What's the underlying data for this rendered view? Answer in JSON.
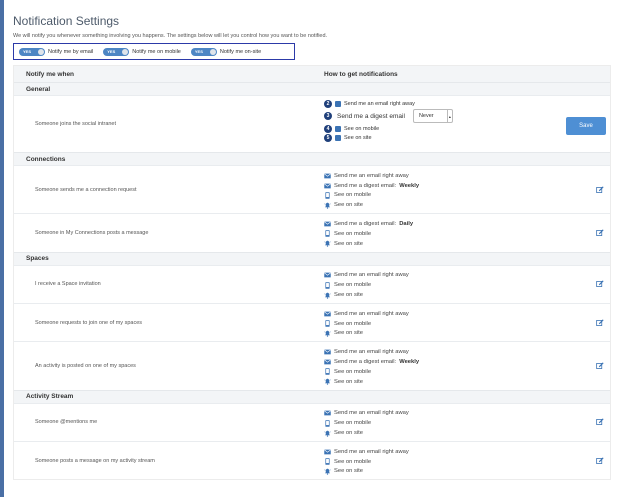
{
  "page": {
    "title": "Notification Settings",
    "intro": "We will notify you whenever something involving you happens. The settings below will let you control how you want to be notified."
  },
  "master": {
    "badge": "1",
    "toggles": [
      {
        "state": "YES",
        "label": "Notify me by email"
      },
      {
        "state": "YES",
        "label": "Notify me on mobile"
      },
      {
        "state": "YES",
        "label": "Notify me on-site"
      }
    ]
  },
  "table": {
    "col_when": "Notify me when",
    "col_how": "How to get notifications"
  },
  "general": {
    "title": "General",
    "row_label": "Someone joins the social intranet",
    "badges": [
      "2",
      "3",
      "4",
      "5"
    ],
    "email_label": "Send me an email right away",
    "digest_label": "Send me a digest email",
    "digest_value": "Never",
    "mobile_label": "See on mobile",
    "site_label": "See on site",
    "save_label": "Save"
  },
  "sections": [
    {
      "title": "Connections",
      "rows": [
        {
          "label": "Someone sends me a connection request",
          "lines": [
            {
              "icon": "email-icon",
              "text": "Send me an email right away",
              "strong": ""
            },
            {
              "icon": "email-icon",
              "text": "Send me a digest email: ",
              "strong": "Weekly"
            },
            {
              "icon": "mobile-icon",
              "text": "See on mobile",
              "strong": ""
            },
            {
              "icon": "bell-icon",
              "text": "See on site",
              "strong": ""
            }
          ]
        },
        {
          "label": "Someone in My Connections posts a message",
          "lines": [
            {
              "icon": "email-icon",
              "text": "Send me a digest email: ",
              "strong": "Daily"
            },
            {
              "icon": "mobile-icon",
              "text": "See on mobile",
              "strong": ""
            },
            {
              "icon": "bell-icon",
              "text": "See on site",
              "strong": ""
            }
          ]
        }
      ]
    },
    {
      "title": "Spaces",
      "rows": [
        {
          "label": "I receive a Space invitation",
          "lines": [
            {
              "icon": "email-icon",
              "text": "Send me an email right away",
              "strong": ""
            },
            {
              "icon": "mobile-icon",
              "text": "See on mobile",
              "strong": ""
            },
            {
              "icon": "bell-icon",
              "text": "See on site",
              "strong": ""
            }
          ]
        },
        {
          "label": "Someone requests to join one of my spaces",
          "lines": [
            {
              "icon": "email-icon",
              "text": "Send me an email right away",
              "strong": ""
            },
            {
              "icon": "mobile-icon",
              "text": "See on mobile",
              "strong": ""
            },
            {
              "icon": "bell-icon",
              "text": "See on site",
              "strong": ""
            }
          ]
        },
        {
          "label": "An activity is posted on one of my spaces",
          "lines": [
            {
              "icon": "email-icon",
              "text": "Send me an email right away",
              "strong": ""
            },
            {
              "icon": "email-icon",
              "text": "Send me a digest email: ",
              "strong": "Weekly"
            },
            {
              "icon": "mobile-icon",
              "text": "See on mobile",
              "strong": ""
            },
            {
              "icon": "bell-icon",
              "text": "See on site",
              "strong": ""
            }
          ]
        }
      ]
    },
    {
      "title": "Activity Stream",
      "rows": [
        {
          "label": "Someone @mentions me",
          "lines": [
            {
              "icon": "email-icon",
              "text": "Send me an email right away",
              "strong": ""
            },
            {
              "icon": "mobile-icon",
              "text": "See on mobile",
              "strong": ""
            },
            {
              "icon": "bell-icon",
              "text": "See on site",
              "strong": ""
            }
          ]
        },
        {
          "label": "Someone posts a message on my activity stream",
          "lines": [
            {
              "icon": "email-icon",
              "text": "Send me an email right away",
              "strong": ""
            },
            {
              "icon": "mobile-icon",
              "text": "See on mobile",
              "strong": ""
            },
            {
              "icon": "bell-icon",
              "text": "See on site",
              "strong": ""
            }
          ]
        }
      ]
    }
  ],
  "colors": {
    "accent": "#4e8fd4",
    "badge": "#1f3f7a",
    "outline": "#2c3aa8",
    "icon": "#3b73b4"
  }
}
